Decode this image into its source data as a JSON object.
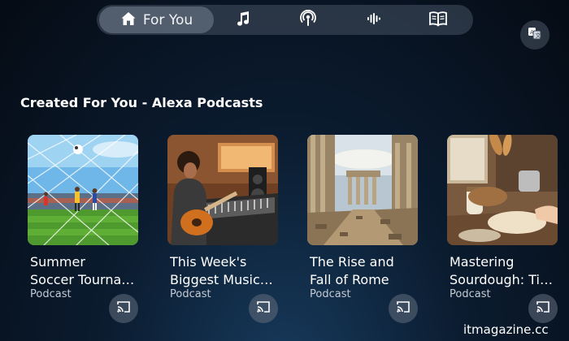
{
  "nav": {
    "active_label": "For You",
    "items": [
      {
        "icon": "home-icon",
        "label": "For You"
      },
      {
        "icon": "music-note-icon"
      },
      {
        "icon": "podcast-icon"
      },
      {
        "icon": "audio-wave-icon"
      },
      {
        "icon": "book-icon"
      }
    ]
  },
  "corner_button_icon": "translate-icon",
  "section": {
    "title": "Created For You - Alexa Podcasts"
  },
  "cards": [
    {
      "title_line1": "Summer",
      "title_line2": "Soccer Tourna…",
      "subtitle": "Podcast",
      "image": "soccer-image",
      "cast_icon": "cast-icon"
    },
    {
      "title_line1": "This Week's",
      "title_line2": "Biggest Music…",
      "subtitle": "Podcast",
      "image": "guitar-studio-image",
      "cast_icon": "cast-icon"
    },
    {
      "title_line1": "The Rise and",
      "title_line2": "Fall of Rome",
      "subtitle": "Podcast",
      "image": "rome-ruins-image",
      "cast_icon": "cast-icon"
    },
    {
      "title_line1": "Mastering",
      "title_line2": "Sourdough: Ti…",
      "subtitle": "Podcast",
      "image": "sourdough-image",
      "cast_icon": "cast-icon"
    }
  ],
  "watermark": "itmagazine.cc"
}
